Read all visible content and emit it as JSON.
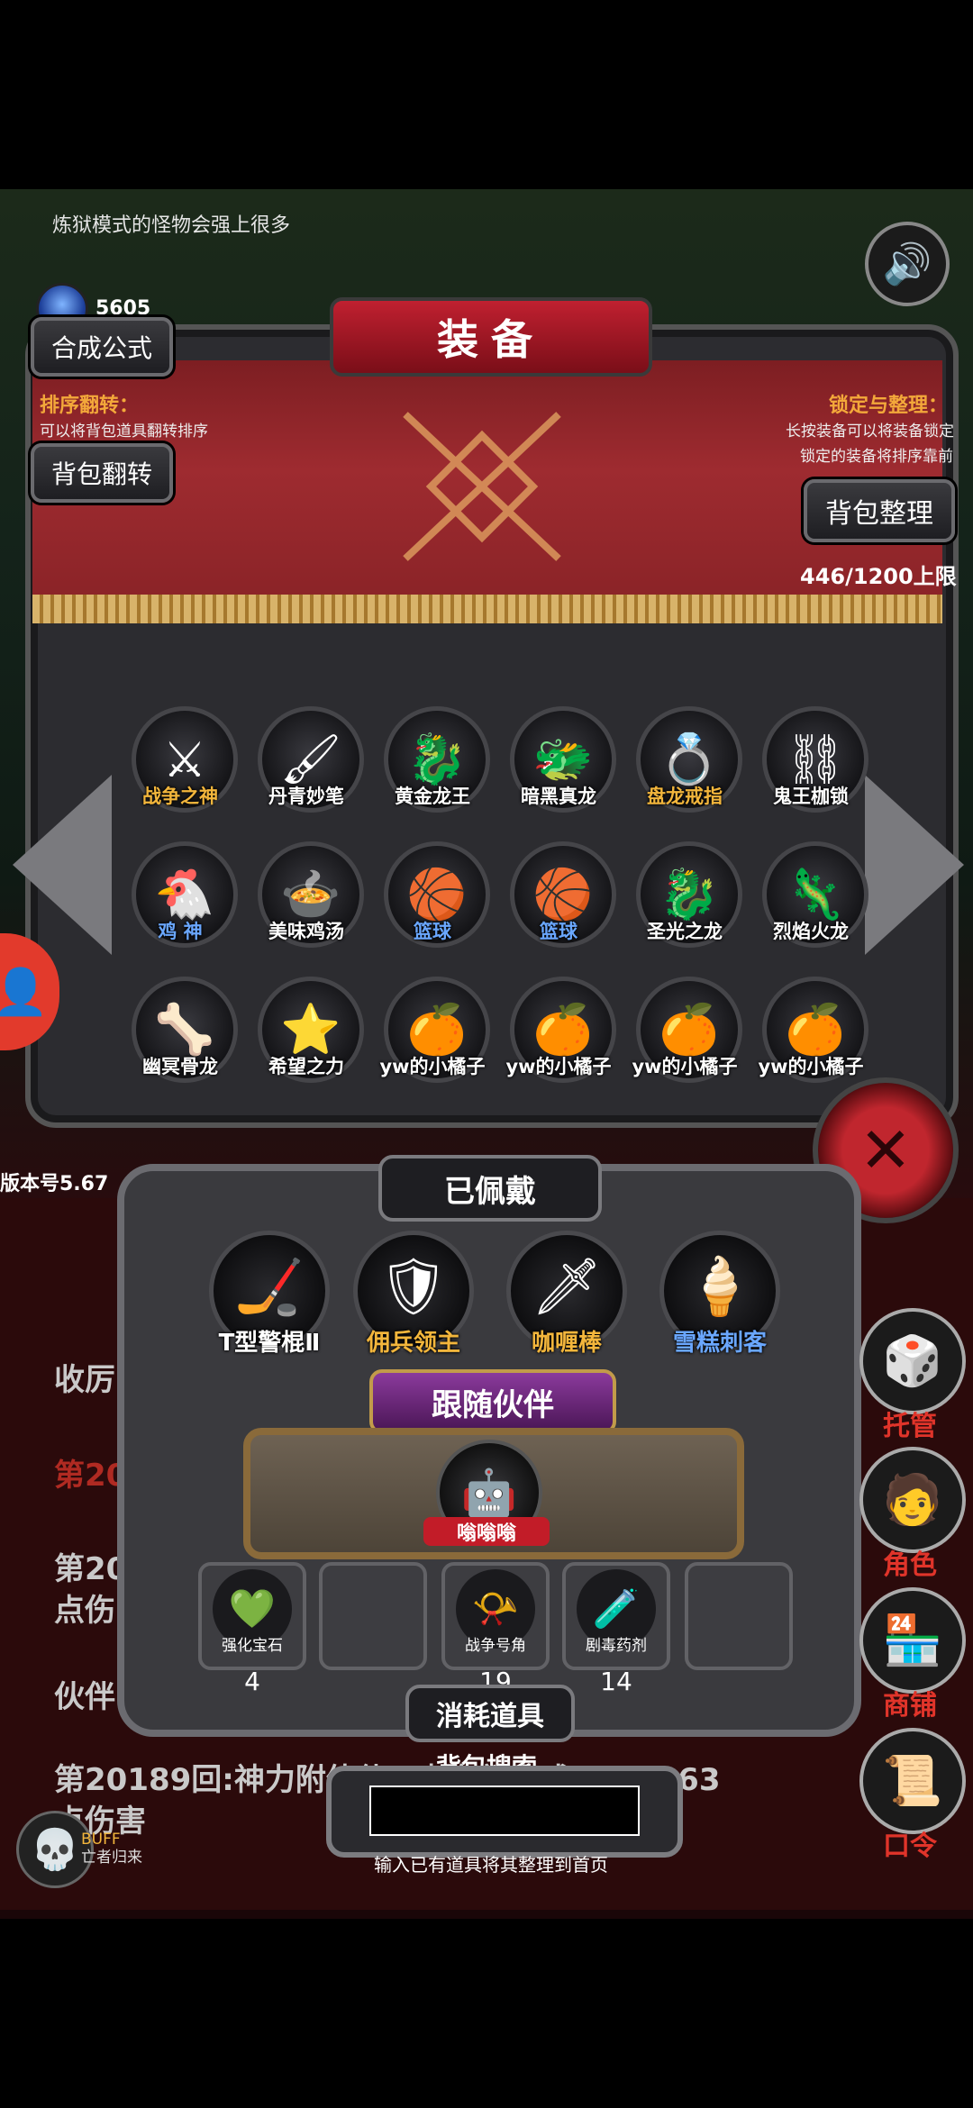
{
  "hint_text": "炼狱模式的怪物会强上很多",
  "gem_count": "5605",
  "title": "装备",
  "buttons": {
    "formula": "合成公式",
    "flip": "背包翻转",
    "sort": "背包整理"
  },
  "flip_info": {
    "title": "排序翻转：",
    "desc": "可以将背包道具翻转排序"
  },
  "lock_info": {
    "title": "锁定与整理：",
    "desc1": "长按装备可以将装备锁定",
    "desc2": "锁定的装备将排序靠前"
  },
  "capacity": "446/1200上限",
  "version": "版本号5.67",
  "items": [
    {
      "name": "战争之神",
      "color": "gold",
      "icon": "⚔"
    },
    {
      "name": "丹青妙笔",
      "color": "white",
      "icon": "🖌"
    },
    {
      "name": "黄金龙王",
      "color": "white",
      "icon": "🐉"
    },
    {
      "name": "暗黑真龙",
      "color": "white",
      "icon": "🐲"
    },
    {
      "name": "盘龙戒指",
      "color": "gold",
      "icon": "💍"
    },
    {
      "name": "鬼王枷锁",
      "color": "white",
      "icon": "⛓"
    },
    {
      "name": "鸡  神",
      "color": "blue",
      "icon": "🐔"
    },
    {
      "name": "美味鸡汤",
      "color": "white",
      "icon": "🍲"
    },
    {
      "name": "篮球",
      "color": "blue",
      "icon": "🏀"
    },
    {
      "name": "篮球",
      "color": "blue",
      "icon": "🏀"
    },
    {
      "name": "圣光之龙",
      "color": "white",
      "icon": "🐉"
    },
    {
      "name": "烈焰火龙",
      "color": "white",
      "icon": "🦎"
    },
    {
      "name": "幽冥骨龙",
      "color": "white",
      "icon": "🦴"
    },
    {
      "name": "希望之力",
      "color": "white",
      "icon": "⭐"
    },
    {
      "name": "yw的小橘子",
      "color": "white",
      "icon": "🍊"
    },
    {
      "name": "yw的小橘子",
      "color": "white",
      "icon": "🍊"
    },
    {
      "name": "yw的小橘子",
      "color": "white",
      "icon": "🍊"
    },
    {
      "name": "yw的小橘子",
      "color": "white",
      "icon": "🍊"
    }
  ],
  "equipped_title": "已佩戴",
  "equipped": [
    {
      "name": "T型警棍Ⅱ",
      "color": "#ffffff",
      "icon": "🏒"
    },
    {
      "name": "佣兵领主",
      "color": "#f3b63c",
      "icon": "🛡"
    },
    {
      "name": "咖喱棒",
      "color": "#f3b63c",
      "icon": "🗡"
    },
    {
      "name": "雪糕刺客",
      "color": "#6aa7ff",
      "icon": "🍦"
    }
  ],
  "follow_title": "跟随伙伴",
  "companion_name": "嗡嗡嗡",
  "consumables": [
    {
      "name": "强化宝石",
      "count": "4",
      "icon": "💚"
    },
    {
      "name": "",
      "count": "",
      "icon": ""
    },
    {
      "name": "战争号角",
      "count": "19",
      "icon": "📯"
    },
    {
      "name": "剧毒药剂",
      "count": "14",
      "icon": "🧪"
    },
    {
      "name": "",
      "count": "",
      "icon": ""
    }
  ],
  "consume_title": "消耗道具",
  "search": {
    "label": "背包搜索",
    "placeholder": "",
    "hint": "输入已有道具将其整理到首页"
  },
  "side_nav": [
    "托管",
    "角色",
    "商铺",
    "口令"
  ],
  "log": {
    "l1": "收厉",
    "l2": "第201",
    "l3": "第20",
    "l3b": "点伤",
    "l4": "伙伴",
    "l5": "第20189回:神力附体使用者有效造成6387963",
    "l6": "点伤害"
  },
  "buff": {
    "l1": "BUFF",
    "l2": "亡者归来"
  }
}
